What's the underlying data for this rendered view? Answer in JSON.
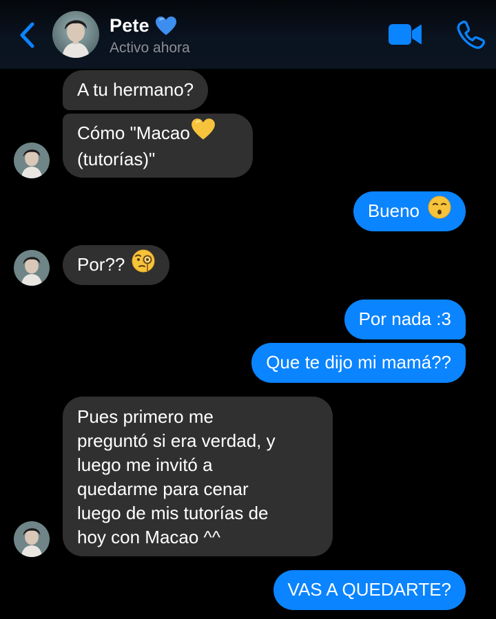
{
  "header": {
    "contact_name": "Pete",
    "status": "Activo ahora",
    "name_emoji": "blue-heart-icon",
    "accent_color": "#0a84ff"
  },
  "messages": [
    {
      "direction": "incoming",
      "text": "A tu hermano?"
    },
    {
      "direction": "incoming",
      "text_lines": [
        "Cómo \"Macao",
        "(tutorías)\""
      ],
      "emoji": "yellow-heart-icon"
    },
    {
      "direction": "outgoing",
      "text": "Bueno",
      "emoji": "kissing-face-icon"
    },
    {
      "direction": "incoming",
      "text": "Por??",
      "emoji": "monocle-face-icon"
    },
    {
      "direction": "outgoing",
      "text": "Por nada :3"
    },
    {
      "direction": "outgoing",
      "text": "Que te dijo mi mamá??"
    },
    {
      "direction": "incoming",
      "text_lines": [
        "Pues primero me",
        "preguntó si era verdad, y",
        "luego me invitó a",
        "quedarme para cenar",
        "luego de mis tutorías de",
        "hoy con Macao ^^"
      ]
    },
    {
      "direction": "outgoing",
      "text": "VAS A QUEDARTE?"
    }
  ],
  "colors": {
    "incoming_bubble": "#303030",
    "outgoing_bubble": "#0a84ff",
    "background": "#000000",
    "status_text": "#8e8e93"
  }
}
